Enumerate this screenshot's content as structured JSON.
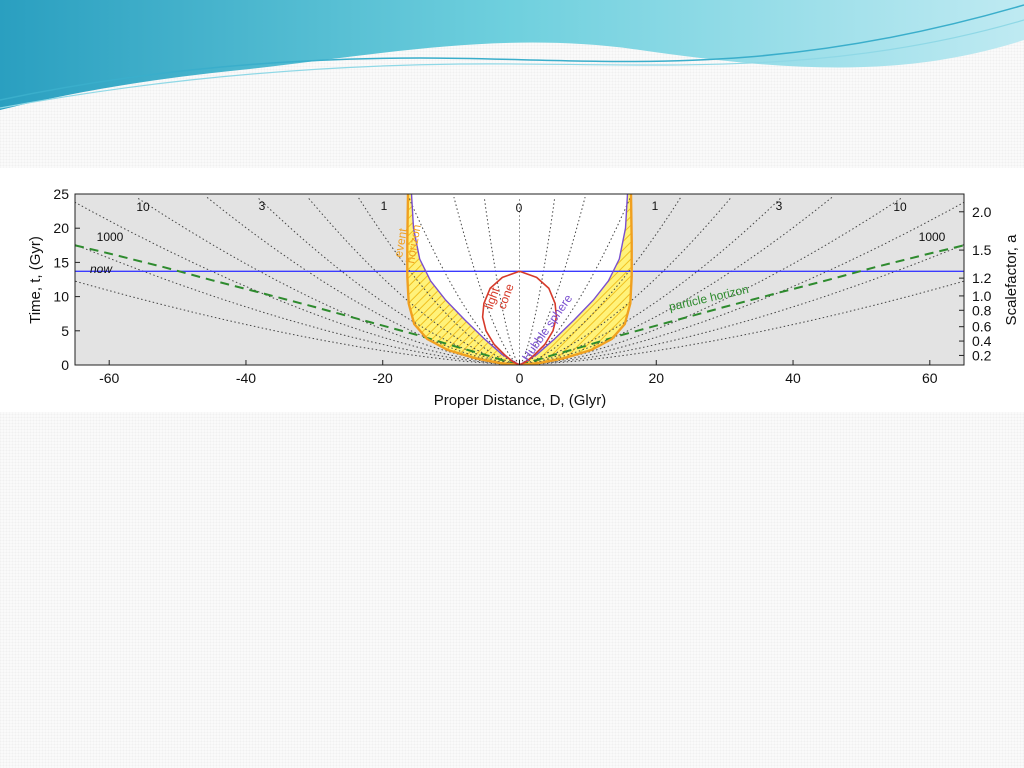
{
  "colors": {
    "plot_background": "#e3e3e3",
    "now_line": "#3b3bff",
    "particle_horizon": "#2e8b2e",
    "event_horizon": "#f0a020",
    "light_cone": "#d63a2a",
    "hubble_sphere": "#7a4fd0",
    "shaded_region": "#fff27a",
    "header_wave": "#5fc6d9"
  },
  "chart_data": {
    "type": "line",
    "xlabel": "Proper Distance, D, (Glyr)",
    "ylabel": "Time, t, (Gyr)",
    "ylabel_right": "Scalefactor, a",
    "xlim": [
      -65,
      65
    ],
    "ylim": [
      0,
      25
    ],
    "x_ticks": [
      -60,
      -40,
      -20,
      0,
      20,
      40,
      60
    ],
    "y_ticks": [
      0,
      5,
      10,
      15,
      20,
      25
    ],
    "right_ticks": [
      {
        "label": "0.2",
        "t": 1.4
      },
      {
        "label": "0.4",
        "t": 3.5
      },
      {
        "label": "0.6",
        "t": 5.6
      },
      {
        "label": "0.8",
        "t": 8.0
      },
      {
        "label": "1.0",
        "t": 10.1
      },
      {
        "label": "1.2",
        "t": 12.7
      },
      {
        "label": "1.5",
        "t": 16.8
      },
      {
        "label": "2.0",
        "t": 22.4
      }
    ],
    "annotations": {
      "now": "now",
      "event_horizon": [
        "event",
        "horizon"
      ],
      "light_cone": [
        "light",
        "cone"
      ],
      "hubble_sphere": "Hubble sphere",
      "particle_horizon": "particle horizon"
    },
    "redshift_labels": [
      "0",
      "1",
      "3",
      "10",
      "1000"
    ],
    "now_t": 13.7,
    "series": [
      {
        "key": "particle_left",
        "x": [
          -65,
          -60,
          -52,
          -45,
          -38,
          -30,
          -22,
          -15,
          -9,
          -4,
          -1.5,
          0
        ],
        "y": [
          17.5,
          16.3,
          14.3,
          12.4,
          10.6,
          8.5,
          6.3,
          4.4,
          2.6,
          1.2,
          0.4,
          0
        ]
      },
      {
        "key": "particle_right",
        "x": [
          0,
          1.5,
          4,
          9,
          15,
          22,
          30,
          38,
          45,
          52,
          60,
          65
        ],
        "y": [
          0,
          0.4,
          1.2,
          2.6,
          4.4,
          6.3,
          8.5,
          10.6,
          12.4,
          14.3,
          16.3,
          17.5
        ]
      },
      {
        "key": "event_left",
        "x": [
          -16.3,
          -16.4,
          -16.4,
          -16.2,
          -15.4,
          -13.5,
          -10.5,
          -6.5,
          -3,
          0
        ],
        "y": [
          25,
          18,
          13,
          9,
          6,
          3.8,
          2.2,
          1,
          0.3,
          0
        ]
      },
      {
        "key": "event_right",
        "x": [
          0,
          3,
          6.5,
          10.5,
          13.5,
          15.4,
          16.2,
          16.4,
          16.4,
          16.3
        ],
        "y": [
          0,
          0.3,
          1,
          2.2,
          3.8,
          6,
          9,
          13,
          18,
          25
        ]
      },
      {
        "key": "hubble_left",
        "x": [
          -15.8,
          -15.5,
          -14.6,
          -13,
          -10.8,
          -8,
          -5,
          -2.5,
          0
        ],
        "y": [
          25,
          20,
          15.5,
          12.3,
          9.5,
          6.6,
          3.7,
          1.5,
          0
        ]
      },
      {
        "key": "hubble_right",
        "x": [
          0,
          2.5,
          5,
          8,
          10.8,
          13,
          14.6,
          15.5,
          15.8
        ],
        "y": [
          0,
          1.5,
          3.7,
          6.6,
          9.5,
          12.3,
          15.5,
          20,
          25
        ]
      },
      {
        "key": "light_cone",
        "x": [
          0,
          -2.5,
          -4.3,
          -5.2,
          -5.4,
          -4.9,
          -3.7,
          -2.2,
          -1.0,
          0,
          1.0,
          2.2,
          3.7,
          4.9,
          5.4,
          5.2,
          4.3,
          2.5,
          0
        ],
        "y": [
          13.7,
          12.8,
          11.2,
          9.0,
          7.0,
          5.0,
          3.0,
          1.5,
          0.5,
          0,
          0.5,
          1.5,
          3.0,
          5.0,
          7.0,
          9.0,
          11.2,
          12.8,
          13.7
        ]
      }
    ],
    "comoving_worldlines": [
      {
        "label": "0",
        "chi": 0
      },
      {
        "label": "1",
        "chi": 11
      },
      {
        "label": "3",
        "chi": 21
      },
      {
        "label": "10",
        "chi": 31
      },
      {
        "label": "1000",
        "chi": 45
      },
      {
        "chi": 3.5
      },
      {
        "chi": 6.5
      },
      {
        "chi": 16
      },
      {
        "chi": 26
      },
      {
        "chi": 38
      },
      {
        "chi": 55
      },
      {
        "chi": 70
      }
    ]
  }
}
